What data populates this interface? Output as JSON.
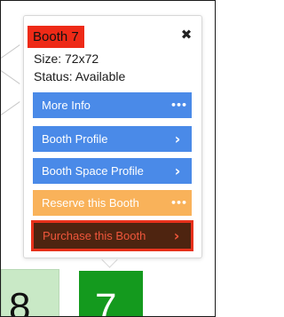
{
  "popup": {
    "title": "Booth 7",
    "size_text": "Size: 72x72",
    "status_text": "Status: Available",
    "close_glyph": "✖",
    "buttons": [
      {
        "label": "More Info",
        "icon": "more-dots-icon",
        "glyph": "•••",
        "color": "#4a8ae8"
      },
      {
        "label": "Booth Profile",
        "icon": "chevron-right-icon",
        "glyph": "›",
        "color": "#4a8ae8"
      },
      {
        "label": "Booth Space Profile",
        "icon": "chevron-right-icon",
        "glyph": "›",
        "color": "#4a8ae8"
      },
      {
        "label": "Reserve this Booth",
        "icon": "more-dots-icon",
        "glyph": "•••",
        "color": "#f9b25a"
      },
      {
        "label": "Purchase this Booth",
        "icon": "chevron-right-icon",
        "glyph": "›",
        "color": "#4e2410"
      }
    ],
    "highlight_color": "#ee2a17"
  },
  "map": {
    "booths": [
      {
        "number": "8",
        "color": "#c9e9c6"
      },
      {
        "number": "7",
        "color": "#149a1e"
      }
    ]
  }
}
